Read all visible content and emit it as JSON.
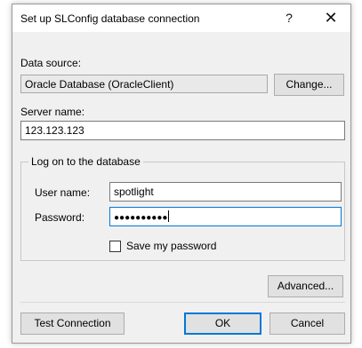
{
  "dialog": {
    "title": "Set up SLConfig database connection",
    "help_label": "?",
    "close_label": "✕"
  },
  "data_source": {
    "label": "Data source:",
    "value": "Oracle Database (OracleClient)",
    "change_button": "Change..."
  },
  "server": {
    "label": "Server name:",
    "value": "123.123.123"
  },
  "logon": {
    "group_label": "Log on to the database",
    "username_label": "User name:",
    "username_value": "spotlight",
    "password_label": "Password:",
    "password_value": "●●●●●●●●●●",
    "save_password_label": "Save my password",
    "save_password_checked": false
  },
  "buttons": {
    "advanced": "Advanced...",
    "test_connection": "Test Connection",
    "ok": "OK",
    "cancel": "Cancel"
  },
  "colors": {
    "focus_accent": "#0078d7",
    "dialog_background": "#f0f0f0"
  }
}
